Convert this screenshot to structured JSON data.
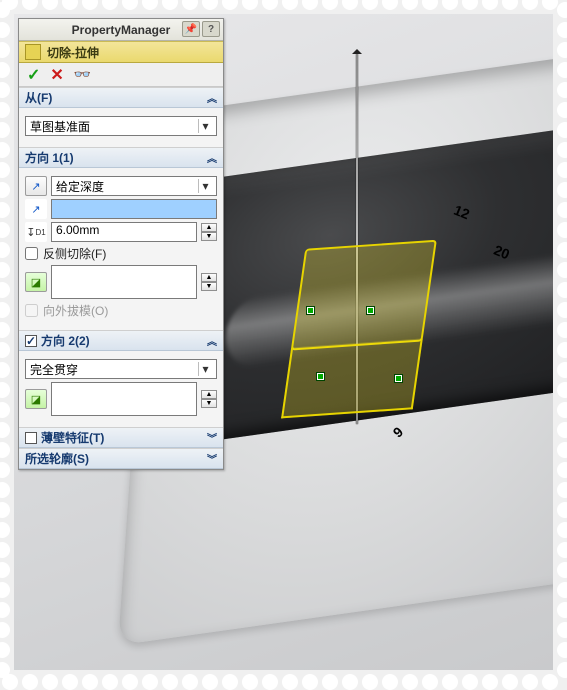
{
  "pm": {
    "title": "PropertyManager",
    "feature": {
      "label": "切除-拉伸"
    },
    "actions": {
      "ok": "✓",
      "cancel": "✕",
      "preview": "👓"
    },
    "sections": {
      "from": {
        "header": "从(F)",
        "combo": "草图基准面"
      },
      "dir1": {
        "header": "方向 1(1)",
        "end_condition": "给定深度",
        "distance_value": "",
        "depth_value": "6.00mm",
        "flip_side": "反侧切除(F)",
        "draft_outward": "向外拔模(O)"
      },
      "dir2": {
        "header": "方向 2(2)",
        "checked": true,
        "end_condition": "完全贯穿"
      },
      "thin": {
        "header": "薄壁特征(T)",
        "checked": false
      },
      "contours": {
        "header": "所选轮廓(S)"
      }
    }
  },
  "model_dims": {
    "d12": "12",
    "d20": "20",
    "d9": "9"
  }
}
